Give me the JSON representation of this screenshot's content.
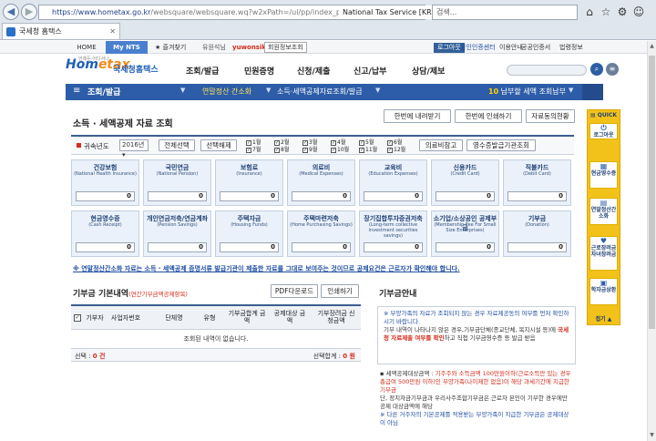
{
  "browser": {
    "url_main": "https://www.hometax.go.kr",
    "url_rest": "/websquare/websquare.wq?w2xPath=/ui/pp/index_pp.xml&tmIdx=1&",
    "site_identity": "National Tax Service [KR]",
    "search_placeholder": "검색...",
    "tab_title": "국세청 홈택스"
  },
  "topbar": {
    "home": "HOME",
    "mynts": "My NTS",
    "favorites": "★ 즐겨찾기",
    "user_status": "유원석님",
    "username": "yuwonsik",
    "member_info": "회원정보조회",
    "logout": "로그아웃",
    "cert_center": "공인인증센터",
    "guide": "이용안내",
    "public_cert": "공공인증서",
    "law": "법령정보"
  },
  "header": {
    "logo_main": "Hom",
    "logo_accent": "etax",
    "logo_kr": "국세청홈택스",
    "logo_small": "언제든·어디서나",
    "gnb": [
      "조회/발급",
      "민원증명",
      "신청/제출",
      "신고/납부",
      "상담/제보"
    ]
  },
  "subnav": {
    "title": "조회/발급",
    "crumb1": "연말정산 간소화",
    "crumb2": "소득·세액공제자료조회/발급",
    "deadline_num": "10",
    "deadline_text": " 납부할 세액 조회납부"
  },
  "page": {
    "title": "소득 · 세액공제 자료 조회",
    "btn_view_all": "한번에 내려받기",
    "btn_print_all": "한번에 인쇄하기",
    "btn_consent": "자료동의현황"
  },
  "yearbar": {
    "label": "귀속년도",
    "year": "2016년 ▾",
    "select_all": "전체선택",
    "deselect_all": "선택해제",
    "months_top": [
      "1월",
      "2월",
      "3월",
      "4월",
      "5월",
      "6월"
    ],
    "months_bottom": [
      "7월",
      "8월",
      "9월",
      "10월",
      "11월",
      "12월"
    ],
    "btn_medical_ref": "의료비참고",
    "btn_issuer": "영수증발급기관조회"
  },
  "categories": [
    {
      "name": "건강보험",
      "eng": "(National Health Insurance)",
      "value": "0"
    },
    {
      "name": "국민연금",
      "eng": "(National Pension)",
      "value": "0"
    },
    {
      "name": "보험료",
      "eng": "(Insurance)",
      "value": "0"
    },
    {
      "name": "의료비",
      "eng": "(Medical Expenses)",
      "value": "0"
    },
    {
      "name": "교육비",
      "eng": "(Education Expenses)",
      "value": "0"
    },
    {
      "name": "신용카드",
      "eng": "(Credit Card)",
      "value": "0"
    },
    {
      "name": "직불카드",
      "eng": "(Debit Card)",
      "value": "0"
    },
    {
      "name": "현금영수증",
      "eng": "(Cash Receipt)",
      "value": "0"
    },
    {
      "name": "개인연금저축/연금계좌",
      "eng": "(Pension Savings)",
      "value": "0"
    },
    {
      "name": "주택자금",
      "eng": "(Housing Funds)",
      "value": "0"
    },
    {
      "name": "주택마련저축",
      "eng": "(Home Purchasing Savings)",
      "value": "0"
    },
    {
      "name": "장기집합투자증권저축",
      "eng": "(Long-term collective investment securities savings)",
      "value": "0"
    },
    {
      "name": "소기업/소상공인 공제부금",
      "eng": "(Membership Fee For Small Size Enterprises)",
      "value": "0"
    },
    {
      "name": "기부금",
      "eng": "(Donation)",
      "value": "0"
    }
  ],
  "notice": "※ 연말정산간소화 자료는 소득 · 세액공제 증명서류 발급기관이 제출한 자료를 그대로 보여주는 것이므로 공제요건은 근로자가 확인해야 합니다.",
  "donation": {
    "title": "기부금 기본내역",
    "title_note": "(연간기부금액공제항목)",
    "btn_pdf": "PDF다운로드",
    "btn_print": "인쇄하기",
    "headers": [
      "기부자",
      "사업자번호",
      "단체명",
      "유형",
      "기부금합계 금액",
      "공제대상 금액",
      "기부장려금 신청금액"
    ],
    "empty": "조회된 내역이 없습니다.",
    "select_label": "선택 : ",
    "select_count": "0 건",
    "sum_label": "선택합계 : ",
    "sum_value": "0 원"
  },
  "guide": {
    "title": "기부금안내",
    "box1_line1": "※ 부양가족의 자료가 조회되지 않는 경우 자료제공동의 여부를 먼저 확인하시기 바랍니다.",
    "box1_line2": "기부 내역이 나타나지 않은 경우,기부금단체(종교단체, 복지시설 등)에 ",
    "box1_red": "국세청 자료제출 여부를 확인",
    "box1_line3": "하고 직접 기부금영수증 등 발급 받음",
    "box2_line1a": "▪ 세액공제대상금액 : ",
    "box2_red1": "기주주와 소득금액 100만원이하(근로소득만 있는 경우 총급여 500만원 이하)인 부양가족(나이제한 없음)이 해당 과세기간에 지급한 기부금",
    "box2_line2": "단, 정치자금기부금과 우리사주조합기부금은 근로자 본인이 기부한 경우에만 공제 대상금액에 해당",
    "box2_line3": "※ 다른 거주자의 기본공제를 적용받는 부양가족이 지급한 기부금은 공제대상이 아님"
  },
  "quick": {
    "title": "▤ QUICK",
    "items": [
      {
        "label": "로그아웃",
        "icon": "⏻"
      },
      {
        "label": "현금영수증",
        "icon": "▦"
      },
      {
        "label": "연말정산간소화",
        "icon": "▤"
      },
      {
        "label": "근로장려금자녀장려금",
        "icon": "♥"
      },
      {
        "label": "학자금상환",
        "icon": "▣"
      }
    ],
    "close": "접기 ▲"
  }
}
